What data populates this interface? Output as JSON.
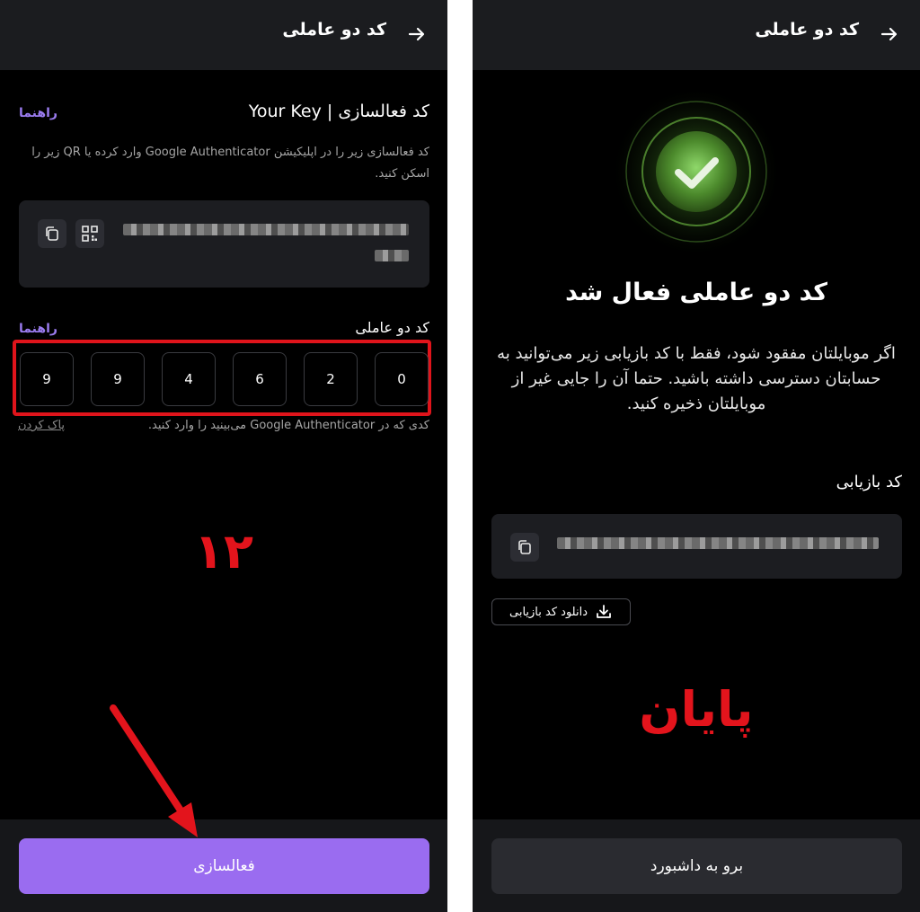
{
  "left": {
    "header": {
      "title": "کد دو عاملی"
    },
    "key": {
      "title": "کد فعالسازی | Your Key",
      "guide": "راهنما",
      "description": "کد فعالسازی زیر را در اپلیکیشن Google Authenticator وارد کرده یا QR زیر را اسکن کنید."
    },
    "two_factor": {
      "label": "کد دو عاملی",
      "guide": "راهنما",
      "digits": [
        "0",
        "2",
        "6",
        "4",
        "9",
        "9"
      ],
      "hint": "کدی که در Google Authenticator می‌بینید را وارد کنید.",
      "clear": "پاک کردن"
    },
    "step_number": "۱۲",
    "activate_button": "فعالسازی"
  },
  "right": {
    "header": {
      "title": "کد دو عاملی"
    },
    "success_title": "کد دو عاملی فعال شد",
    "description": "اگر موبایلتان مفقود شود، فقط با کد بازیابی زیر می‌توانید به حسابتان دسترسی داشته باشید. حتما آن را جایی غیر از موبایلتان ذخیره کنید.",
    "recovery_label": "کد بازیابی",
    "download_button": "دانلود کد بازیابی",
    "end_text": "پایان",
    "dashboard_button": "برو به داشبورد"
  },
  "colors": {
    "accent": "#9a6cf0",
    "link": "#9b7cf0",
    "annotation_red": "#e3141c",
    "success_green": "#6fbf3a",
    "panel_bg": "#000000"
  },
  "icons": [
    "arrow-right-icon",
    "copy-icon",
    "qr-code-icon",
    "check-icon",
    "download-icon"
  ]
}
